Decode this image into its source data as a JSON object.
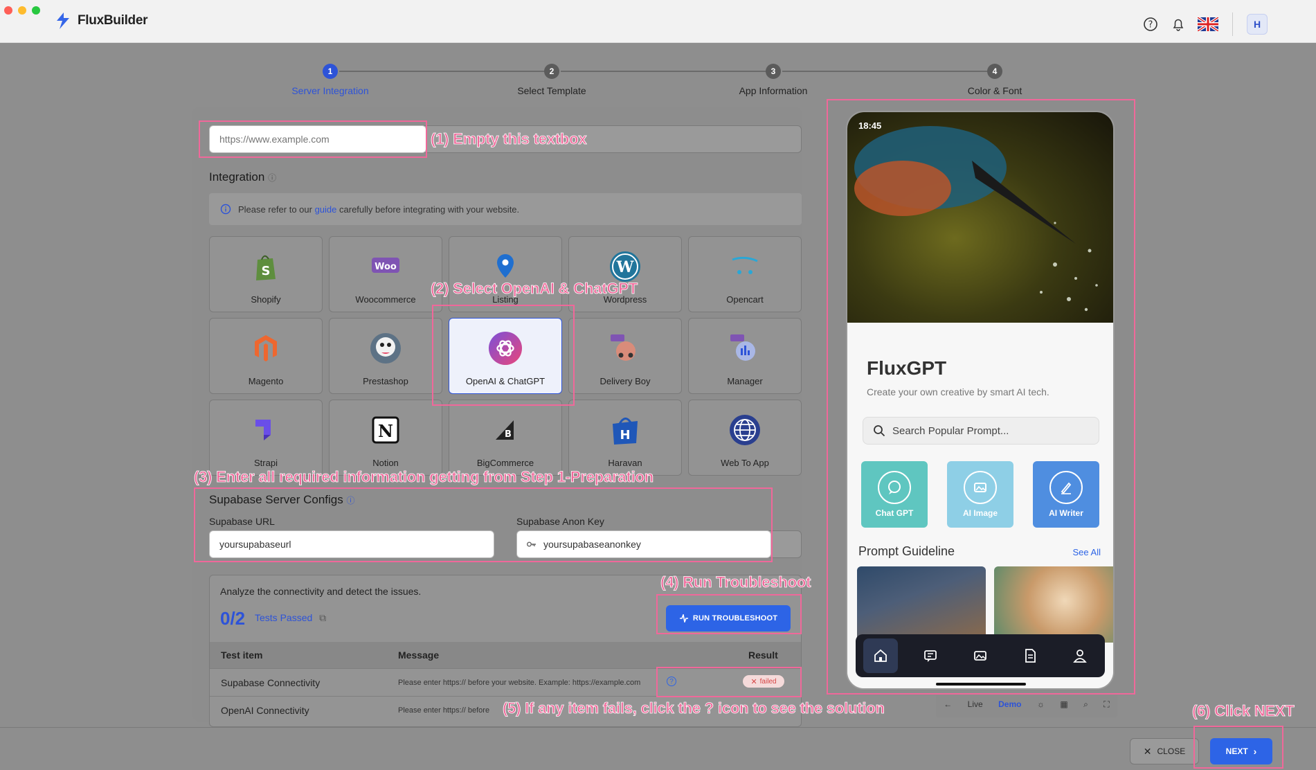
{
  "app": {
    "name": "FluxBuilder"
  },
  "header": {
    "help_icon": "help-icon",
    "bell_icon": "bell-icon",
    "avatar_letter": "H"
  },
  "steps": [
    {
      "num": "1",
      "label": "Server Integration",
      "active": true
    },
    {
      "num": "2",
      "label": "Select Template",
      "active": false
    },
    {
      "num": "3",
      "label": "App Information",
      "active": false
    },
    {
      "num": "4",
      "label": "Color & Font",
      "active": false
    }
  ],
  "website": {
    "placeholder": "https://www.example.com"
  },
  "integration": {
    "title": "Integration",
    "info_prefix": "Please refer to our",
    "info_link": "guide",
    "info_suffix": "carefully before integrating with your website.",
    "platforms": [
      "Shopify",
      "Woocommerce",
      "Listing",
      "Wordpress",
      "Opencart",
      "Magento",
      "Prestashop",
      "OpenAI & ChatGPT",
      "Delivery Boy",
      "Manager",
      "Strapi",
      "Notion",
      "BigCommerce",
      "Haravan",
      "Web To App"
    ],
    "selected": "OpenAI & ChatGPT"
  },
  "supabase": {
    "title": "Supabase Server Configs",
    "url_label": "Supabase URL",
    "url_value": "yoursupabaseurl",
    "key_label": "Supabase Anon Key",
    "key_value": "yoursupabaseanonkey"
  },
  "troubleshoot": {
    "description": "Analyze the connectivity and detect the issues.",
    "score": "0/2",
    "tests_passed": "Tests Passed",
    "run_label": "RUN TROUBLESHOOT",
    "columns": [
      "Test item",
      "Message",
      "Result"
    ],
    "rows": [
      {
        "item": "Supabase Connectivity",
        "message": "Please enter https:// before your website. Example: https://example.com",
        "result": "failed"
      },
      {
        "item": "OpenAI Connectivity",
        "message": "Please enter https:// before"
      }
    ]
  },
  "preview": {
    "status_time": "18:45",
    "app_title": "FluxGPT",
    "app_subtitle": "Create your own creative by smart AI tech.",
    "search_placeholder": "Search Popular Prompt...",
    "features": [
      {
        "label": "Chat GPT",
        "color": "#5fc6c0"
      },
      {
        "label": "AI Image",
        "color": "#8ecfe6"
      },
      {
        "label": "AI Writer",
        "color": "#4f8ee0"
      }
    ],
    "guideline_title": "Prompt Guideline",
    "see_all": "See All",
    "tools": {
      "live": "Live",
      "demo": "Demo"
    }
  },
  "footer": {
    "close_label": "CLOSE",
    "next_label": "NEXT"
  },
  "annotations": [
    "(1) Empty this textbox",
    "(2) Select OpenAI & ChatGPT",
    "(3) Enter all required information getting from Step 1-Preparation",
    "(4) Run Troubleshoot",
    "(5) If any item fails, click the ? icon to see the solution",
    "(6) Click NEXT"
  ],
  "colors": {
    "accent": "#2d53d8",
    "annotation": "#f0689a",
    "failed": "#d64545"
  }
}
